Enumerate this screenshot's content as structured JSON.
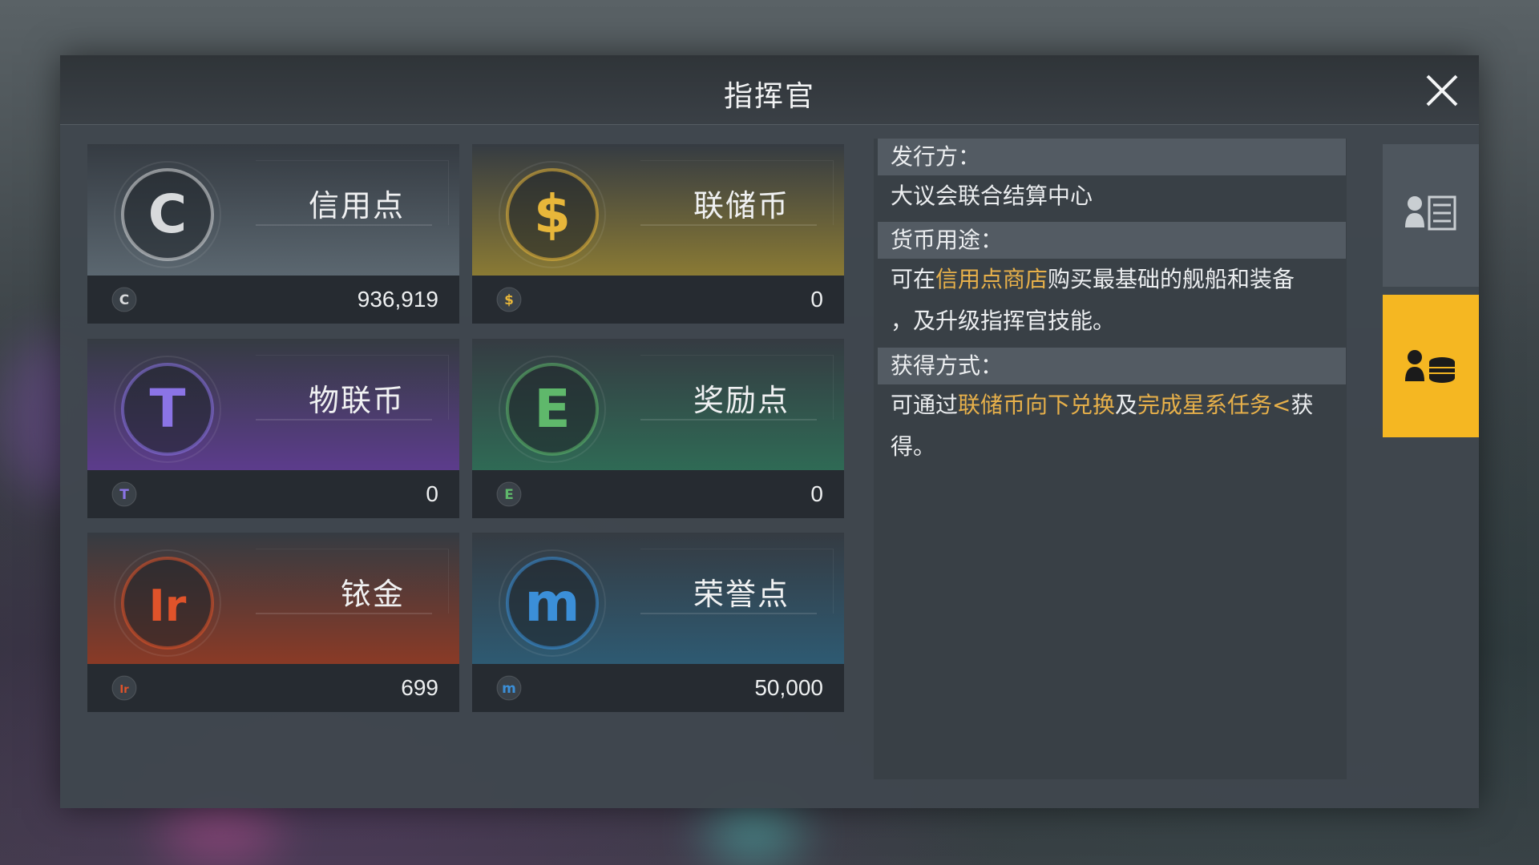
{
  "dialog": {
    "title": "指挥官",
    "close_label": "✕"
  },
  "currencies": [
    {
      "name": "信用点",
      "amount": "936,919",
      "symbol": "C",
      "color": "#d8dadc",
      "theme": "#5b6770",
      "selected": true
    },
    {
      "name": "联储币",
      "amount": "0",
      "symbol": "$",
      "color": "#e7b63a",
      "theme": "#8a7a34",
      "selected": false
    },
    {
      "name": "物联币",
      "amount": "0",
      "symbol": "T",
      "color": "#8b74e6",
      "theme": "#5c3c8c",
      "selected": false
    },
    {
      "name": "奖励点",
      "amount": "0",
      "symbol": "E",
      "color": "#5fb86b",
      "theme": "#2f6a55",
      "selected": false
    },
    {
      "name": "铱金",
      "amount": "699",
      "symbol": "Ir",
      "color": "#e0532a",
      "theme": "#8a3a26",
      "selected": false
    },
    {
      "name": "荣誉点",
      "amount": "50,000",
      "symbol": "m",
      "color": "#3b8fd8",
      "theme": "#2e5a72",
      "selected": false
    }
  ],
  "info": {
    "issuer_label": "发行方：",
    "issuer_value": "大议会联合结算中心",
    "usage_label": "货币用途：",
    "usage_prefix": "可在",
    "usage_link": "信用点商店",
    "usage_suffix": "购买最基础的舰船和装备",
    "usage_line2": "，及升级指挥官技能。",
    "obtain_label": "获得方式：",
    "obtain_prefix": "可通过",
    "obtain_link1": "联储币向下兑换",
    "obtain_mid": "及",
    "obtain_link2": "完成星系任务<",
    "obtain_suffix": "获",
    "obtain_line2": "得。"
  },
  "tabs": [
    {
      "name": "profile",
      "icon": "profile-list-icon",
      "active": false
    },
    {
      "name": "wallet",
      "icon": "profile-coins-icon",
      "active": true
    }
  ],
  "colors": {
    "accent": "#f5b722",
    "highlight_text": "#e7b04a"
  }
}
